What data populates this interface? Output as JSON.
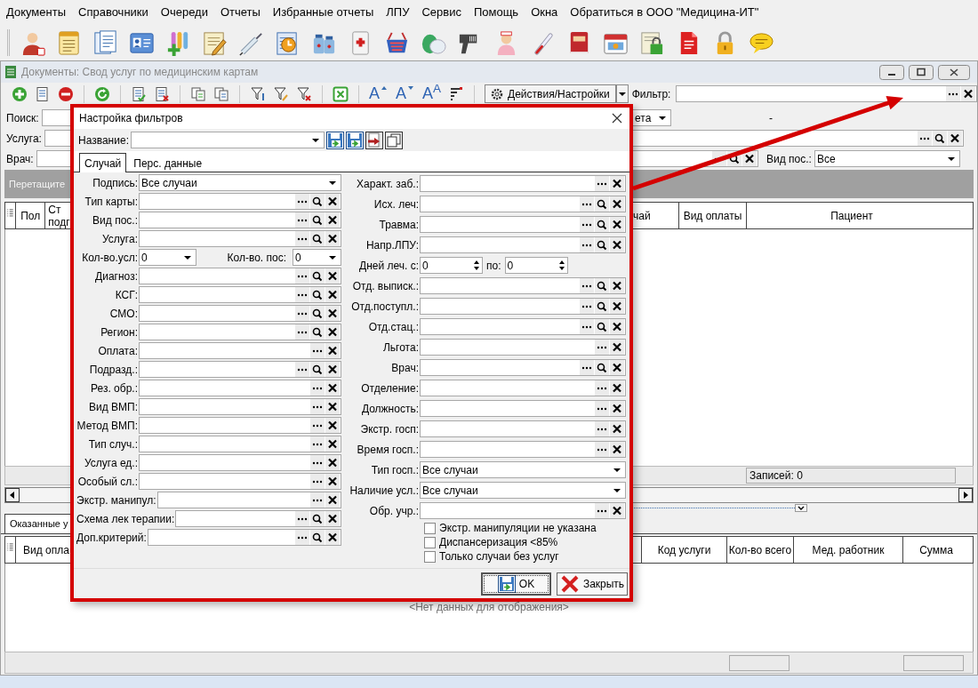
{
  "menu": [
    "Документы",
    "Справочники",
    "Очереди",
    "Отчеты",
    "Избранные отчеты",
    "ЛПУ",
    "Сервис",
    "Помощь",
    "Окна",
    "Обратиться в ООО \"Медицина-ИТ\""
  ],
  "document_window": {
    "title": "Документы: Свод услуг по медицинским картам",
    "toolbar": {
      "font_buttons": [
        "A",
        "A",
        "A$^{A}$"
      ],
      "actions_button": "Действия/Настройки",
      "filter_label": "Фильтр:"
    },
    "search_rows": {
      "search_label": "Поиск:",
      "period_value": "ета",
      "range_dash": "-",
      "service_label": "Услуга:",
      "doctor_label": "Врач:",
      "visit_type_label": "Вид пос.:",
      "visit_type_value": "Все"
    },
    "group_hint": "Перетащите",
    "cases_table": {
      "columns_left": [
        "Пол",
        "Ст подг"
      ],
      "columns_right": [
        "чай",
        "Вид оплаты",
        "Пациент"
      ],
      "records": "Записей: 0"
    },
    "detail_tabs": [
      {
        "label": "Оказанные у",
        "selected": true
      }
    ],
    "services_table": {
      "columns_left": [
        "Вид опла"
      ],
      "columns_right": [
        "Код услуги",
        "Кол-во всего",
        "Мед. работник",
        "Сумма"
      ],
      "empty_text": "<Нет данных для отображения>"
    }
  },
  "filter_dialog": {
    "title": "Настройка фильтров",
    "name_label": "Название:",
    "tabs": [
      {
        "label": "Случай",
        "selected": true
      },
      {
        "label": "Перс. данные",
        "selected": false
      }
    ],
    "left_fields": [
      {
        "kind": "combo",
        "label": "Подпись:",
        "value": "Все случаи"
      },
      {
        "kind": "lookup_search",
        "label": "Тип карты:"
      },
      {
        "kind": "lookup_search",
        "label": "Вид пос.:"
      },
      {
        "kind": "lookup_search",
        "label": "Услуга:"
      },
      {
        "kind": "count_pair",
        "label": "Кол-во.усл:",
        "value": "0",
        "label2": "Кол-во. пос:",
        "value2": "0"
      },
      {
        "kind": "lookup_search",
        "label": "Диагноз:"
      },
      {
        "kind": "lookup_search",
        "label": "КСГ:"
      },
      {
        "kind": "lookup_search",
        "label": "СМО:"
      },
      {
        "kind": "lookup_search",
        "label": "Регион:"
      },
      {
        "kind": "lookup",
        "label": "Оплата:"
      },
      {
        "kind": "lookup_search",
        "label": "Подразд.:"
      },
      {
        "kind": "lookup",
        "label": "Рез. обр.:"
      },
      {
        "kind": "lookup",
        "label": "Вид ВМП:"
      },
      {
        "kind": "lookup",
        "label": "Метод ВМП:"
      },
      {
        "kind": "lookup",
        "label": "Тип случ.:"
      },
      {
        "kind": "lookup",
        "label": "Услуга ед.:"
      },
      {
        "kind": "lookup",
        "label": "Особый сл.:"
      },
      {
        "kind": "lookup",
        "label": "Экстр. манипул:"
      },
      {
        "kind": "lookup_search",
        "label": "Схема лек терапии:"
      },
      {
        "kind": "lookup_search",
        "label": "Доп.критерий:"
      }
    ],
    "right_fields": [
      {
        "kind": "lookup",
        "label": "Характ. заб.:"
      },
      {
        "kind": "lookup_search",
        "label": "Исх. леч:"
      },
      {
        "kind": "lookup_search",
        "label": "Травма:"
      },
      {
        "kind": "lookup_search",
        "label": "Напр.ЛПУ:"
      },
      {
        "kind": "spin_range",
        "label": "Дней леч. с:",
        "value": "0",
        "label2": "по:",
        "value2": "0"
      },
      {
        "kind": "lookup_search",
        "label": "Отд. выписк.:"
      },
      {
        "kind": "lookup_search",
        "label": "Отд.поступл.:"
      },
      {
        "kind": "lookup_search",
        "label": "Отд.стац.:"
      },
      {
        "kind": "lookup",
        "label": "Льгота:"
      },
      {
        "kind": "lookup_search",
        "label": "Врач:"
      },
      {
        "kind": "lookup",
        "label": "Отделение:"
      },
      {
        "kind": "lookup",
        "label": "Должность:"
      },
      {
        "kind": "lookup",
        "label": "Экстр. госп:"
      },
      {
        "kind": "lookup",
        "label": "Время госп.:"
      },
      {
        "kind": "combo",
        "label": "Тип госп.:",
        "value": "Все случаи"
      },
      {
        "kind": "combo",
        "label": "Наличие усл.:",
        "value": "Все случаи"
      },
      {
        "kind": "lookup",
        "label": "Обр. учр.:"
      },
      {
        "kind": "checkbox",
        "label": "Экстр. манипуляции не указана",
        "checked": false
      },
      {
        "kind": "checkbox",
        "label": "Диспансеризация <85%",
        "checked": false
      },
      {
        "kind": "checkbox",
        "label": "Только случаи без услуг",
        "checked": false
      }
    ],
    "buttons": [
      {
        "kind": "ok",
        "label": "OK"
      },
      {
        "kind": "close",
        "label": "Закрыть"
      }
    ]
  }
}
